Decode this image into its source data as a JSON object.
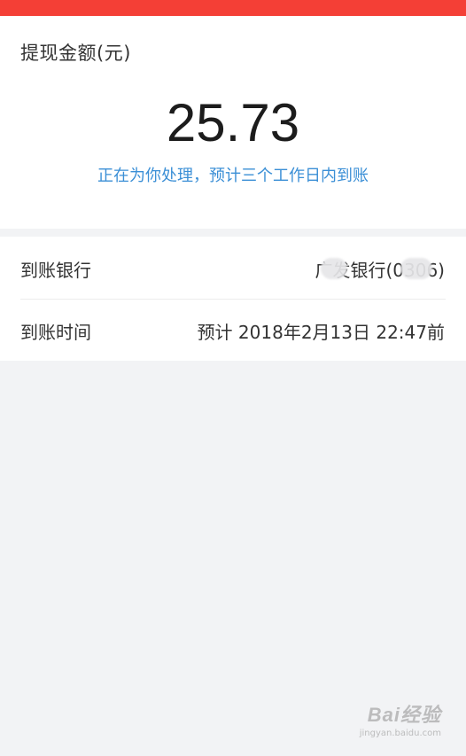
{
  "colors": {
    "top_bar": "#f43f36",
    "status_text": "#3b8fd6",
    "page_background": "#f2f3f5"
  },
  "withdrawal": {
    "label": "提现金额(元)",
    "amount": "25.73",
    "status": "正在为你处理，预计三个工作日内到账"
  },
  "details": [
    {
      "key": "到账银行",
      "value": "广发银行(0306)"
    },
    {
      "key": "到账时间",
      "value": "预计 2018年2月13日 22:47前"
    }
  ],
  "watermark": {
    "logo": "Bai经验",
    "url": "jingyan.baidu.com"
  }
}
